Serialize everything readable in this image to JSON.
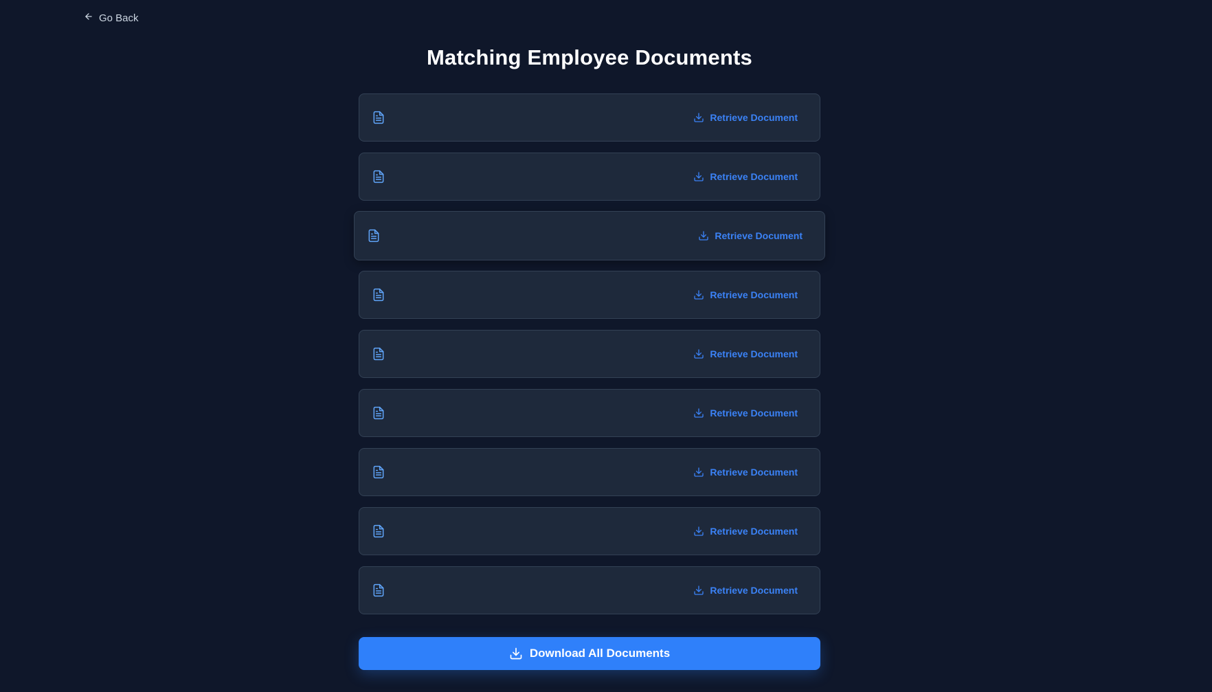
{
  "header": {
    "back_label": "Go Back",
    "title": "Matching Employee Documents"
  },
  "documents": [
    {
      "action_label": "Retrieve Document"
    },
    {
      "action_label": "Retrieve Document"
    },
    {
      "action_label": "Retrieve Document"
    },
    {
      "action_label": "Retrieve Document"
    },
    {
      "action_label": "Retrieve Document"
    },
    {
      "action_label": "Retrieve Document"
    },
    {
      "action_label": "Retrieve Document"
    },
    {
      "action_label": "Retrieve Document"
    },
    {
      "action_label": "Retrieve Document"
    }
  ],
  "footer": {
    "download_all_label": "Download All Documents"
  },
  "icons": {
    "back": "arrow-left-icon",
    "document": "file-text-icon",
    "download": "download-icon"
  },
  "colors": {
    "background": "#0f172a",
    "card": "#1e293b",
    "accent": "#3b82f6",
    "primary_button": "#2f80fa"
  }
}
